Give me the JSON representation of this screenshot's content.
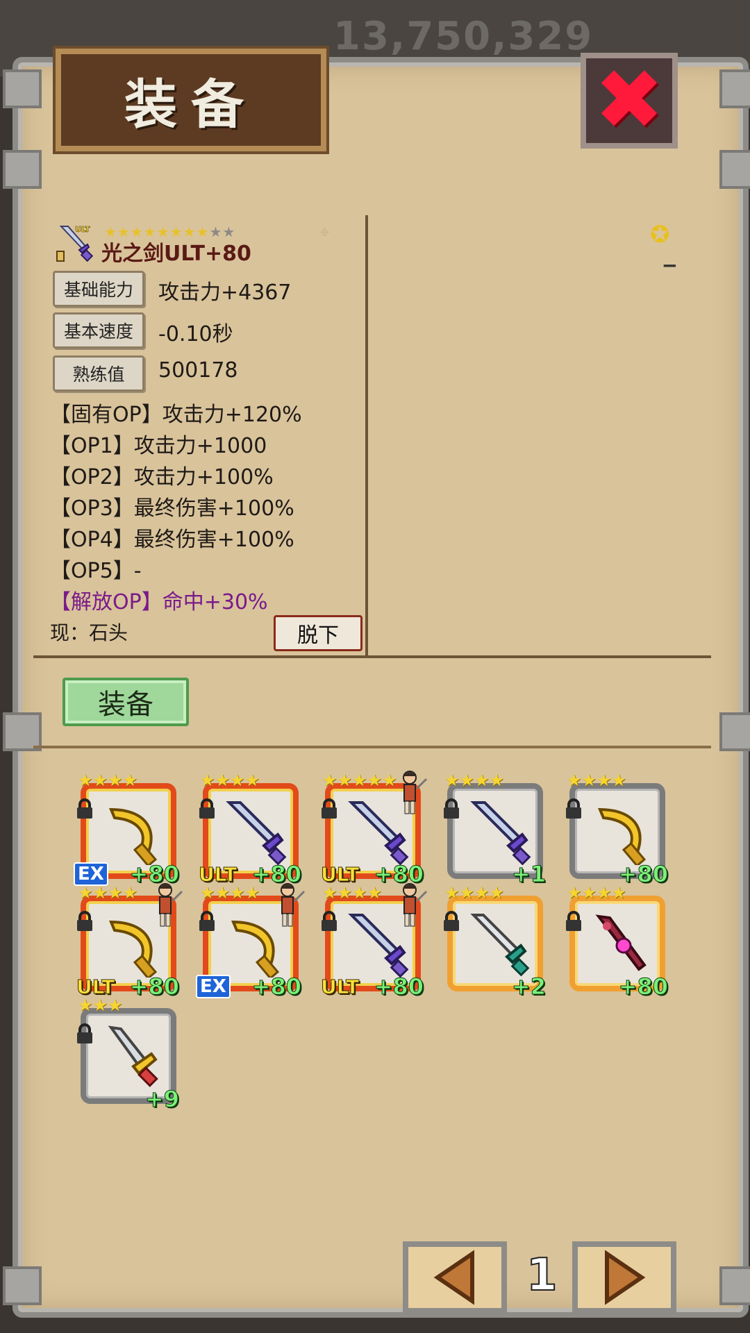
{
  "background": {
    "score": "13,750,329"
  },
  "dialog": {
    "title": "装备",
    "close_icon": "close-icon"
  },
  "item": {
    "name": "光之剑ULT+80",
    "badge": "ULT",
    "stars_filled": 8,
    "stars_total": 10,
    "stats": [
      {
        "label": "基础能力",
        "value": "攻击力+4367"
      },
      {
        "label": "基本速度",
        "value": "-0.10秒"
      },
      {
        "label": "熟练值",
        "value": "500178"
      }
    ],
    "ops": [
      {
        "tag": "【固有OP】",
        "text": "攻击力+120%"
      },
      {
        "tag": "【OP1】",
        "text": "攻击力+1000"
      },
      {
        "tag": "【OP2】",
        "text": "攻击力+100%"
      },
      {
        "tag": "【OP3】",
        "text": "最终伤害+100%"
      },
      {
        "tag": "【OP4】",
        "text": "最终伤害+100%"
      },
      {
        "tag": "【OP5】",
        "text": "-"
      },
      {
        "tag": "【解放OP】",
        "text": "命中+30%"
      }
    ],
    "current": "现：石头",
    "unequip_label": "脱下"
  },
  "actions": {
    "equip_label": "装备"
  },
  "inventory": [
    {
      "frame": "gold",
      "weapon": "golden-scythe",
      "badge": "EX",
      "plus": "+80",
      "stars": "★★★★",
      "char": false
    },
    {
      "frame": "gold",
      "weapon": "light-sword",
      "badge": "ULT",
      "plus": "+80",
      "stars": "★★★★",
      "char": false
    },
    {
      "frame": "gold",
      "weapon": "light-sword",
      "badge": "ULT",
      "plus": "+80",
      "stars": "★★★★★",
      "char": true
    },
    {
      "frame": "grey",
      "weapon": "light-sword",
      "badge": "",
      "plus": "+1",
      "stars": "★★★★",
      "char": false
    },
    {
      "frame": "grey",
      "weapon": "golden-scythe",
      "badge": "",
      "plus": "+80",
      "stars": "★★★★",
      "char": false
    },
    {
      "frame": "gold",
      "weapon": "golden-scythe",
      "badge": "ULT",
      "plus": "+80",
      "stars": "★★★★",
      "char": true
    },
    {
      "frame": "gold",
      "weapon": "golden-scythe",
      "badge": "EX",
      "plus": "+80",
      "stars": "★★★★",
      "char": true
    },
    {
      "frame": "gold",
      "weapon": "light-sword",
      "badge": "ULT",
      "plus": "+80",
      "stars": "★★★★",
      "char": true
    },
    {
      "frame": "orange",
      "weapon": "steel-sword",
      "badge": "",
      "plus": "+2",
      "stars": "★★★★",
      "char": false
    },
    {
      "frame": "orange",
      "weapon": "crimson-staff",
      "badge": "",
      "plus": "+80",
      "stars": "★★★★",
      "char": false
    },
    {
      "frame": "grey",
      "weapon": "gold-hilt-sword",
      "badge": "",
      "plus": "+9",
      "stars": "★★★",
      "char": false
    }
  ],
  "pager": {
    "page": "1"
  },
  "colors": {
    "accent_gold": "#e8c020",
    "frame_gold": "#e24a1a",
    "plus_green": "#7cf07a"
  }
}
